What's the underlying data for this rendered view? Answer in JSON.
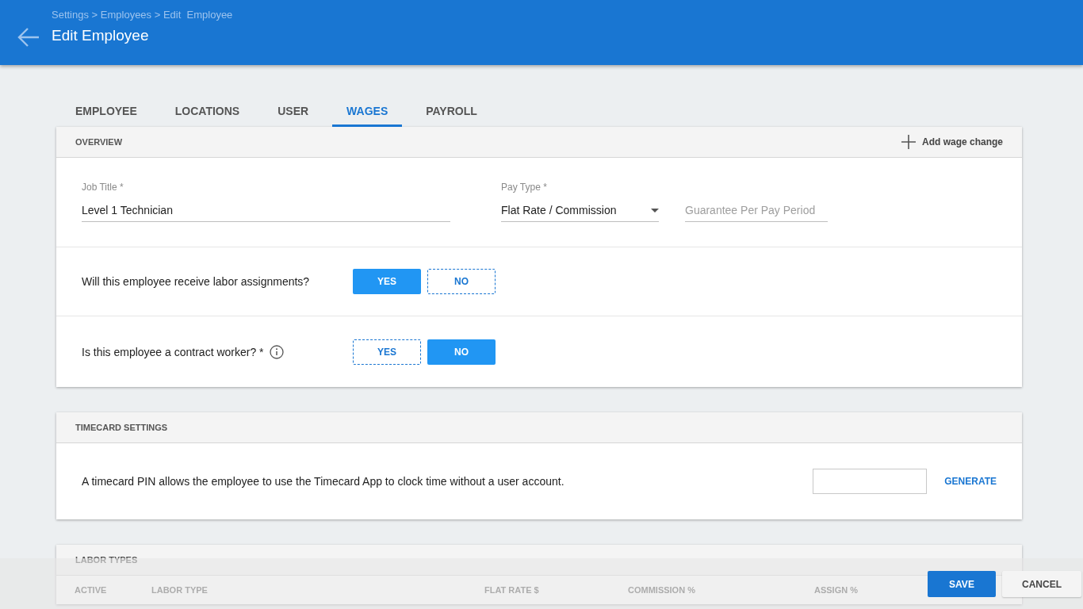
{
  "header": {
    "breadcrumb": "Settings > Employees > Edit  Employee",
    "title": "Edit Employee"
  },
  "tabs": [
    {
      "label": "EMPLOYEE",
      "selected": false
    },
    {
      "label": "LOCATIONS",
      "selected": false
    },
    {
      "label": "USER",
      "selected": false
    },
    {
      "label": "WAGES",
      "selected": true
    },
    {
      "label": "PAYROLL",
      "selected": false
    }
  ],
  "overview": {
    "title": "OVERVIEW",
    "action": "Add wage change",
    "fields": [
      {
        "kind": "text",
        "label": "Job Title *",
        "value": "Level 1 Technician"
      },
      {
        "kind": "select",
        "label": "Pay Type *",
        "value": "Flat Rate / Commission"
      },
      {
        "kind": "text",
        "placeholder": "Guarantee Per Pay Period"
      }
    ],
    "questions": [
      {
        "text": "Will this employee receive labor assignments?",
        "info": false,
        "options": [
          {
            "label": "YES",
            "selected": true
          },
          {
            "label": "NO",
            "selected": false
          }
        ]
      },
      {
        "text": "Is this employee a contract worker? *",
        "info": true,
        "options": [
          {
            "label": "YES",
            "selected": false
          },
          {
            "label": "NO",
            "selected": true
          }
        ]
      }
    ]
  },
  "timecard": {
    "title": "TIMECARD SETTINGS",
    "text": "A timecard PIN allows the employee to use the Timecard App to clock time without a user account.",
    "action": "GENERATE"
  },
  "labor_types": {
    "title": "LABOR TYPES",
    "columns": [
      "ACTIVE",
      "LABOR TYPE",
      "FLAT RATE $",
      "COMMISSION %",
      "ASSIGN %"
    ]
  },
  "footer": {
    "buttons": [
      {
        "label": "SAVE",
        "kind": "primary"
      },
      {
        "label": "CANCEL",
        "kind": "secondary"
      }
    ]
  }
}
